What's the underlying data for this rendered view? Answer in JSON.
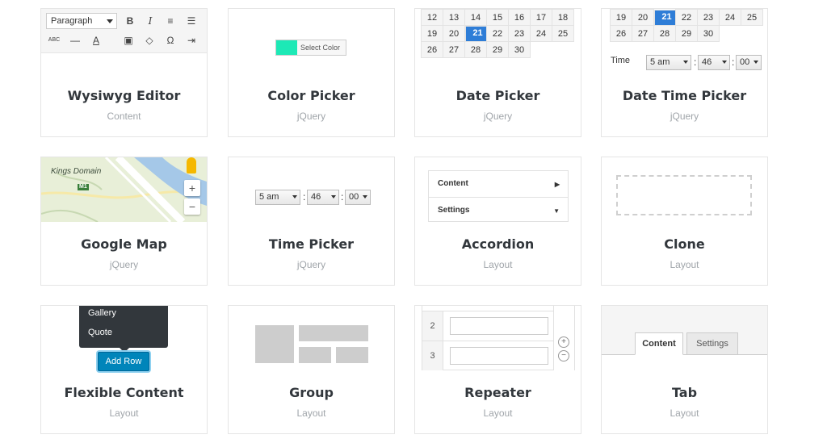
{
  "cards": {
    "wysiwyg": {
      "title": "Wysiwyg Editor",
      "category": "Content",
      "format_select": "Paragraph"
    },
    "color_picker": {
      "title": "Color Picker",
      "category": "jQuery",
      "button_label": "Select Color",
      "swatch_color": "#1de9b6"
    },
    "date_picker": {
      "title": "Date Picker",
      "category": "jQuery",
      "rows": [
        [
          "12",
          "13",
          "14",
          "15",
          "16",
          "17",
          "18"
        ],
        [
          "19",
          "20",
          "21",
          "22",
          "23",
          "24",
          "25"
        ],
        [
          "26",
          "27",
          "28",
          "29",
          "30",
          "",
          ""
        ]
      ],
      "selected": "21"
    },
    "date_time_picker": {
      "title": "Date Time Picker",
      "category": "jQuery",
      "rows": [
        [
          "19",
          "20",
          "21",
          "22",
          "23",
          "24",
          "25"
        ],
        [
          "26",
          "27",
          "28",
          "29",
          "30",
          "",
          ""
        ]
      ],
      "selected": "21",
      "time_label": "Time",
      "hour": "5 am",
      "minute": "46",
      "second": "00"
    },
    "google_map": {
      "title": "Google Map",
      "category": "jQuery",
      "map_label": "Kings Domain",
      "road_label": "M1",
      "zoom_in": "+",
      "zoom_out": "−"
    },
    "time_picker": {
      "title": "Time Picker",
      "category": "jQuery",
      "hour": "5 am",
      "minute": "46",
      "second": "00"
    },
    "accordion": {
      "title": "Accordion",
      "category": "Layout",
      "items": [
        "Content",
        "Settings"
      ]
    },
    "clone": {
      "title": "Clone",
      "category": "Layout"
    },
    "flexible_content": {
      "title": "Flexible Content",
      "category": "Layout",
      "menu_items": [
        "Gallery",
        "Quote"
      ],
      "button_label": "Add Row"
    },
    "group": {
      "title": "Group",
      "category": "Layout"
    },
    "repeater": {
      "title": "Repeater",
      "category": "Layout",
      "row_numbers": [
        "2",
        "3"
      ],
      "add_symbol": "+",
      "remove_symbol": "−"
    },
    "tab": {
      "title": "Tab",
      "category": "Layout",
      "tabs": [
        "Content",
        "Settings"
      ]
    }
  },
  "colors": {
    "accent": "#2e7dd7",
    "button": "#0085ba",
    "dark": "#32373c"
  }
}
